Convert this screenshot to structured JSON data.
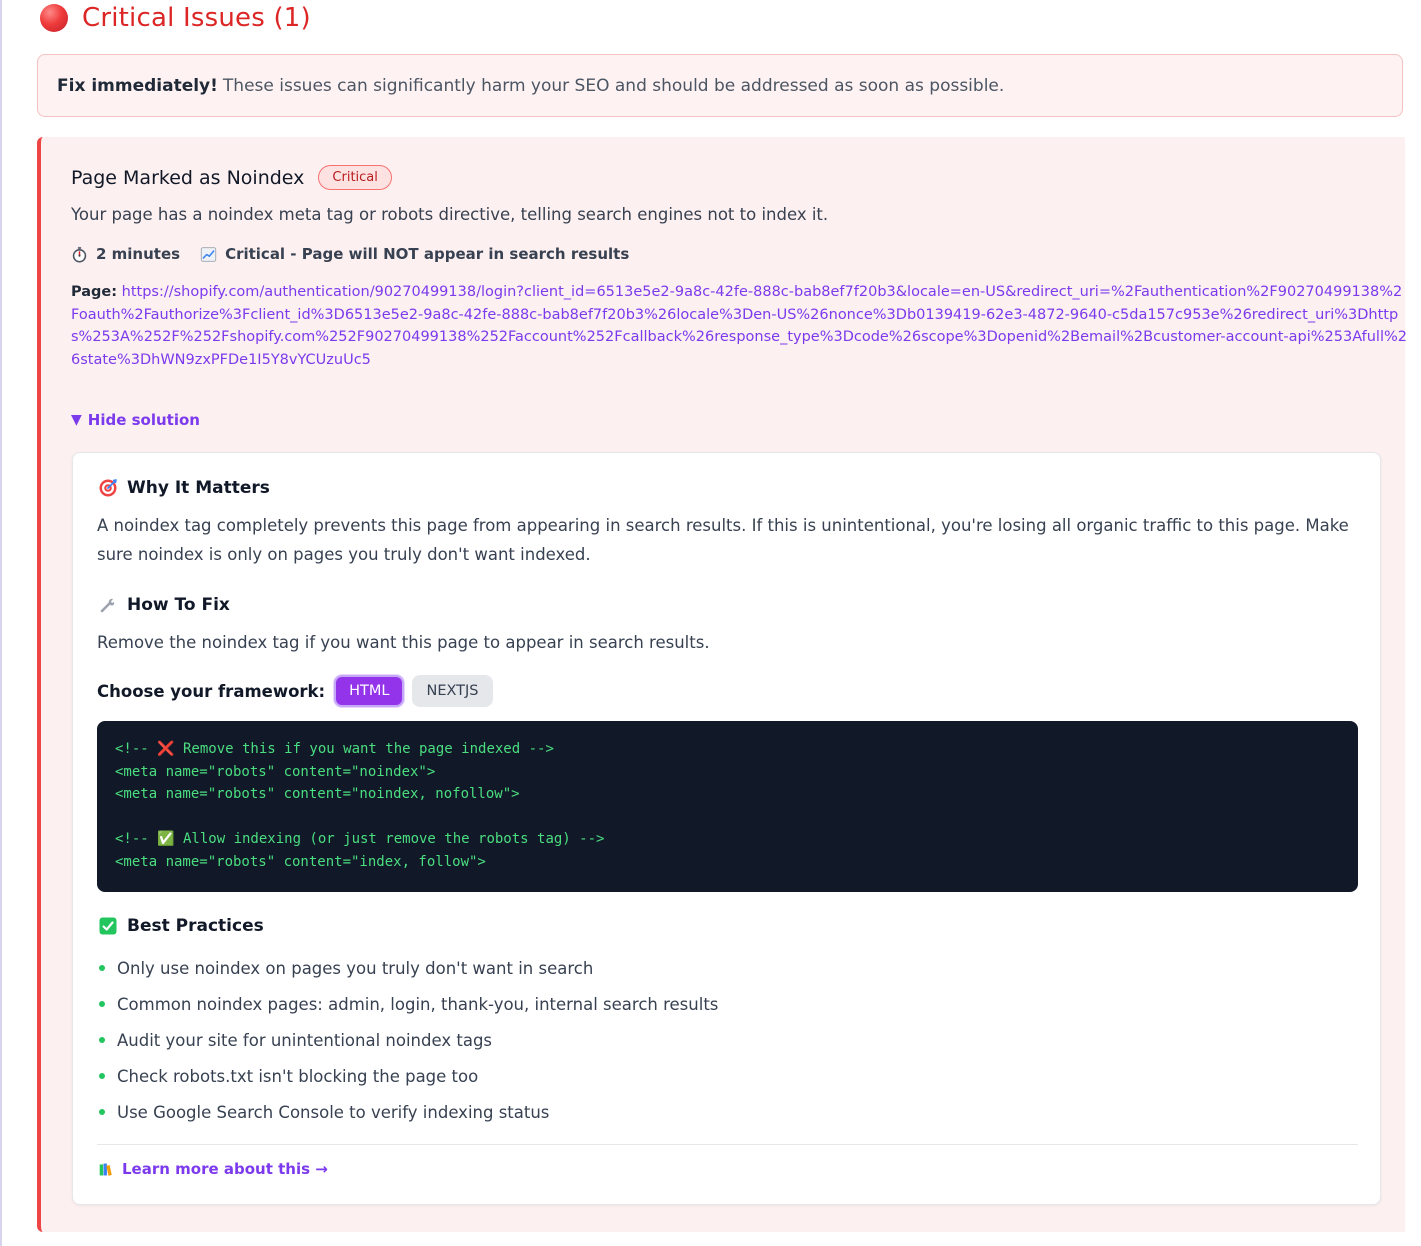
{
  "section": {
    "title": "Critical Issues (1)"
  },
  "alert": {
    "bold": "Fix immediately!",
    "text": "These issues can significantly harm your SEO and should be addressed as soon as possible."
  },
  "issue": {
    "title": "Page Marked as Noindex",
    "badge": "Critical",
    "description": "Your page has a noindex meta tag or robots directive, telling search engines not to index it.",
    "time_icon": "stopwatch-icon",
    "time": "2 minutes",
    "impact_icon": "chart-increasing-icon",
    "impact": "Critical - Page will NOT appear in search results",
    "page_label": "Page:",
    "page_url": "https://shopify.com/authentication/90270499138/login?client_id=6513e5e2-9a8c-42fe-888c-bab8ef7f20b3&locale=en-US&redirect_uri=%2Fauthentication%2F90270499138%2Foauth%2Fauthorize%3Fclient_id%3D6513e5e2-9a8c-42fe-888c-bab8ef7f20b3%26locale%3Den-US%26nonce%3Db0139419-62e3-4872-9640-c5da157c953e%26redirect_uri%3Dhttps%253A%252F%252Fshopify.com%252F90270499138%252Faccount%252Fcallback%26response_type%3Dcode%26scope%3Dopenid%2Bemail%2Bcustomer-account-api%253Afull%26state%3DhWN9zxPFDe1I5Y8vYCUzuUc5",
    "toggle_label": "Hide solution"
  },
  "solution": {
    "why_icon": "target-icon",
    "why_title": "Why It Matters",
    "why_text": "A noindex tag completely prevents this page from appearing in search results. If this is unintentional, you're losing all organic traffic to this page. Make sure noindex is only on pages you truly don't want indexed.",
    "how_icon": "wrench-icon",
    "how_title": "How To Fix",
    "how_text": "Remove the noindex tag if you want this page to appear in search results.",
    "framework_label": "Choose your framework:",
    "frameworks": [
      "HTML",
      "NEXTJS"
    ],
    "active_framework": "HTML",
    "code_lines": [
      "<!-- ❌ Remove this if you want the page indexed -->",
      "<meta name=\"robots\" content=\"noindex\">",
      "<meta name=\"robots\" content=\"noindex, nofollow\">",
      "",
      "<!-- ✅ Allow indexing (or just remove the robots tag) -->",
      "<meta name=\"robots\" content=\"index, follow\">"
    ],
    "bp_icon": "check-mark-button-icon",
    "bp_title": "Best Practices",
    "best_practices": [
      "Only use noindex on pages you truly don't want in search",
      "Common noindex pages: admin, login, thank-you, internal search results",
      "Audit your site for unintentional noindex tags",
      "Check robots.txt isn't blocking the page too",
      "Use Google Search Console to verify indexing status"
    ],
    "learn_icon": "books-icon",
    "learn_more": "Learn more about this →"
  },
  "colors": {
    "critical": "#dc2626",
    "accent": "#7c3aed",
    "button_active": "#9333ea",
    "code_bg": "#111827",
    "code_text": "#4ade80",
    "bullet": "#22c55e"
  }
}
